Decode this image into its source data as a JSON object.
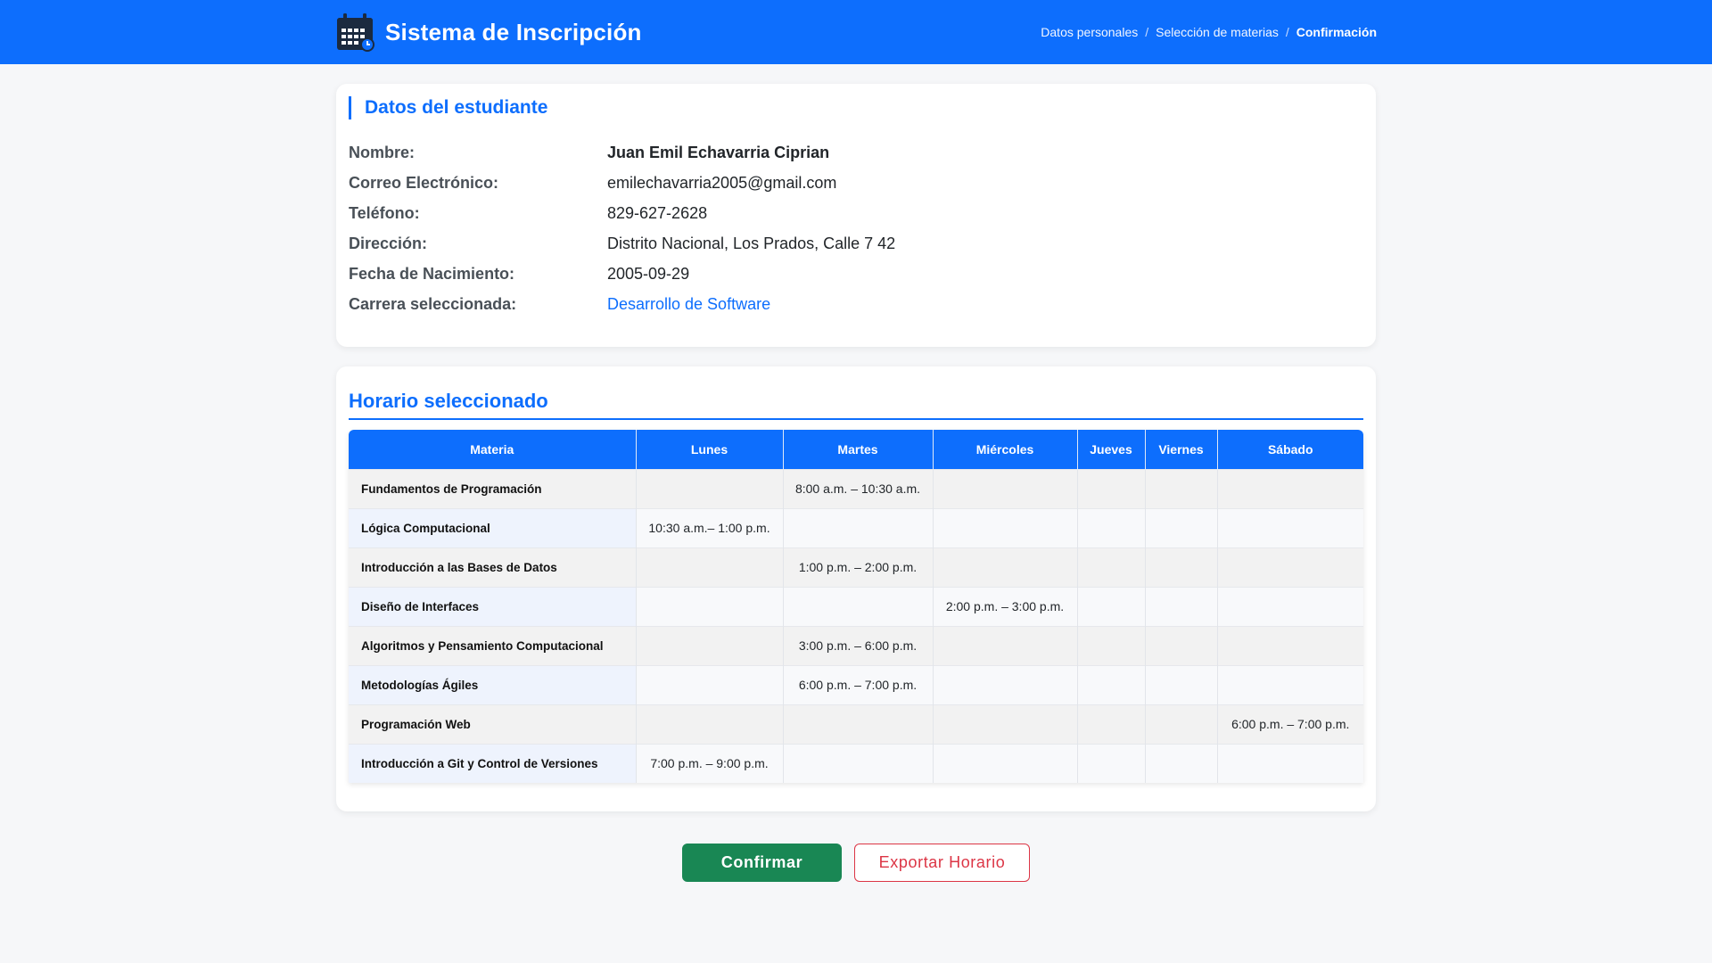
{
  "header": {
    "title": "Sistema de Inscripción",
    "breadcrumb": [
      "Datos personales",
      "Selección de materias",
      "Confirmación"
    ],
    "breadcrumb_separator": "/",
    "brand_color": "#0d6efd",
    "icon": "calendar-icon"
  },
  "student": {
    "section_title": "Datos del estudiante",
    "fields": [
      {
        "label": "Nombre:",
        "value": "Juan Emil Echavarria Ciprian"
      },
      {
        "label": "Correo Electrónico:",
        "value": "emilechavarria2005@gmail.com"
      },
      {
        "label": "Teléfono:",
        "value": "829-627-2628"
      },
      {
        "label": "Dirección:",
        "value": "Distrito Nacional, Los Prados, Calle 7 42"
      },
      {
        "label": "Fecha de Nacimiento:",
        "value": "2005-09-29"
      },
      {
        "label": "Carrera seleccionada:",
        "value": "Desarrollo de Software"
      }
    ]
  },
  "schedule": {
    "section_title": "Horario seleccionado",
    "columns": [
      "Materia",
      "Lunes",
      "Martes",
      "Miércoles",
      "Jueves",
      "Viernes",
      "Sábado"
    ],
    "rows": [
      {
        "subject": "Fundamentos de Programación",
        "cells": [
          "",
          "8:00 a.m. – 10:30 a.m.",
          "",
          "",
          "",
          ""
        ]
      },
      {
        "subject": "Lógica Computacional",
        "cells": [
          "10:30 a.m.– 1:00 p.m.",
          "",
          "",
          "",
          "",
          ""
        ]
      },
      {
        "subject": "Introducción a las Bases de Datos",
        "cells": [
          "",
          "1:00 p.m. – 2:00 p.m.",
          "",
          "",
          "",
          ""
        ]
      },
      {
        "subject": "Diseño de Interfaces",
        "cells": [
          "",
          "",
          "2:00 p.m. – 3:00 p.m.",
          "",
          "",
          ""
        ]
      },
      {
        "subject": "Algoritmos y Pensamiento Computacional",
        "cells": [
          "",
          "3:00 p.m. – 6:00 p.m.",
          "",
          "",
          "",
          ""
        ]
      },
      {
        "subject": "Metodologías Ágiles",
        "cells": [
          "",
          "6:00 p.m. – 7:00 p.m.",
          "",
          "",
          "",
          ""
        ]
      },
      {
        "subject": "Programación Web",
        "cells": [
          "",
          "",
          "",
          "",
          "",
          "6:00 p.m. – 7:00 p.m."
        ]
      },
      {
        "subject": "Introducción a Git y Control de Versiones",
        "cells": [
          "7:00 p.m. – 9:00 p.m.",
          "",
          "",
          "",
          "",
          ""
        ]
      }
    ]
  },
  "actions": {
    "confirm_label": "Confirmar",
    "export_label": "Exportar Horario",
    "confirm_color": "#198754",
    "export_color": "#dc3545"
  }
}
